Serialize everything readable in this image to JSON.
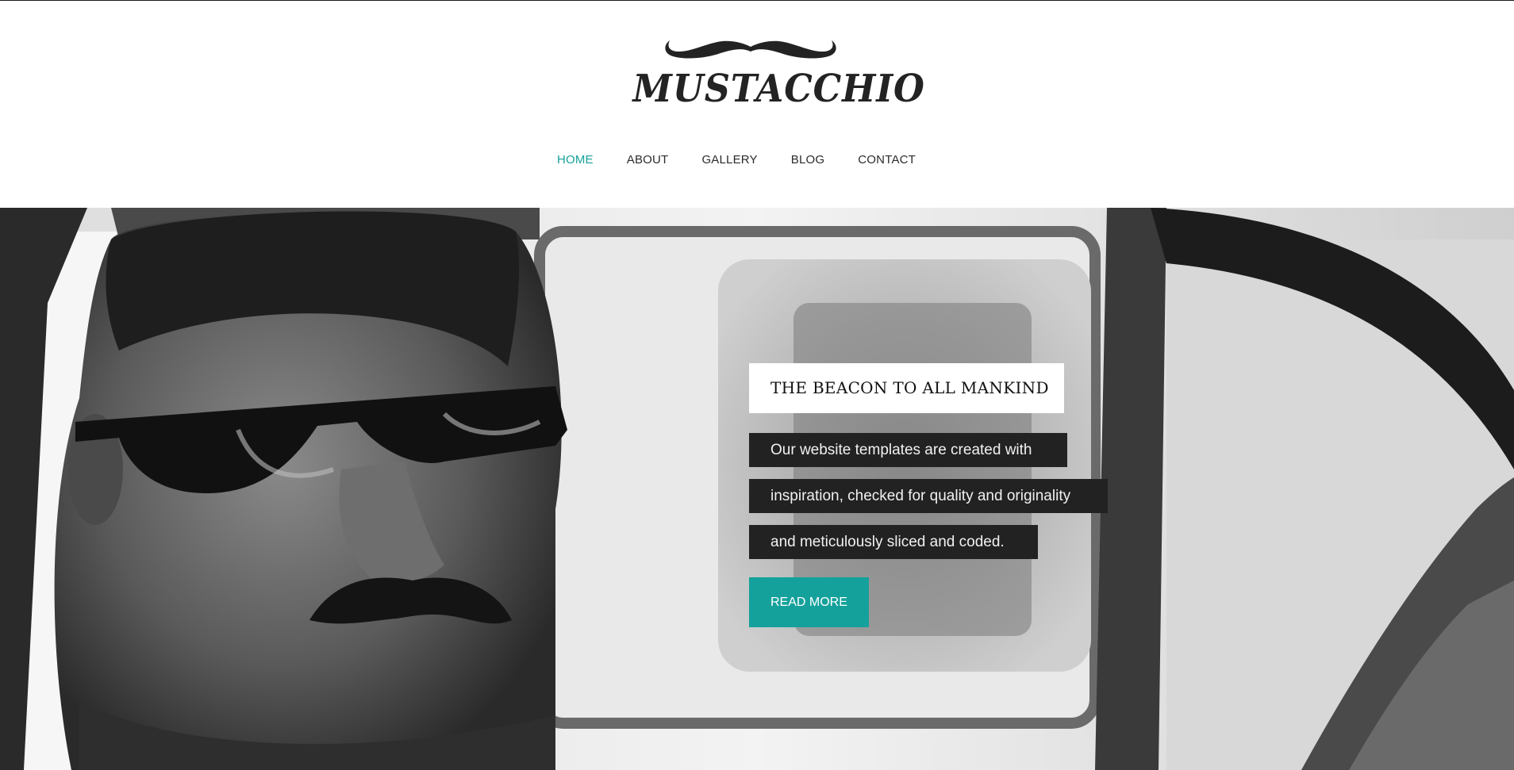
{
  "brand": {
    "name": "MUSTACCHIO",
    "logo_icon": "mustache-icon"
  },
  "nav": {
    "items": [
      {
        "label": "HOME",
        "active": true
      },
      {
        "label": "ABOUT",
        "active": false
      },
      {
        "label": "GALLERY",
        "active": false
      },
      {
        "label": "BLOG",
        "active": false
      },
      {
        "label": "CONTACT",
        "active": false
      }
    ]
  },
  "hero": {
    "image": "black-and-white photo of man with sunglasses and mustache in a car",
    "title": "THE BEACON TO ALL MANKIND",
    "lines": [
      "Our website templates are created with",
      "inspiration, checked for quality and originality",
      "and meticulously sliced and coded."
    ],
    "button_label": "READ MORE"
  },
  "colors": {
    "accent": "#15a19b",
    "text": "#2b2b2b",
    "caption_bg": "#222222",
    "title_bg": "#ffffff"
  }
}
